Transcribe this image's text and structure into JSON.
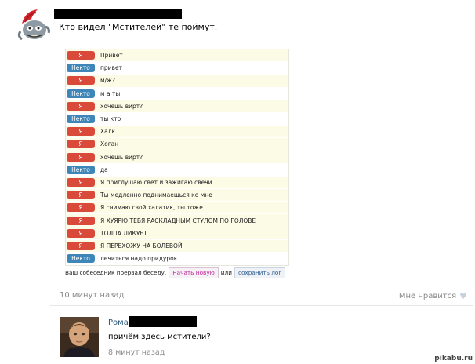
{
  "post": {
    "title": "Кто видел \"Мстителей\" те поймут.",
    "time": "10 минут назад",
    "like_label": "Мне нравится"
  },
  "chat": {
    "messages": [
      {
        "who": "me",
        "badge": "Я",
        "text": "Привет"
      },
      {
        "who": "stranger",
        "badge": "Некто",
        "text": "привет"
      },
      {
        "who": "me",
        "badge": "Я",
        "text": "м/ж?"
      },
      {
        "who": "stranger",
        "badge": "Некто",
        "text": "м а ты"
      },
      {
        "who": "me",
        "badge": "Я",
        "text": "хочешь вирт?"
      },
      {
        "who": "stranger",
        "badge": "Некто",
        "text": "ты кто"
      },
      {
        "who": "me",
        "badge": "Я",
        "text": "Халк."
      },
      {
        "who": "me",
        "badge": "Я",
        "text": "Хоган"
      },
      {
        "who": "me",
        "badge": "Я",
        "text": "хочешь вирт?"
      },
      {
        "who": "stranger",
        "badge": "Некто",
        "text": "да"
      },
      {
        "who": "me",
        "badge": "Я",
        "text": "Я приглушаю свет и зажигаю свечи"
      },
      {
        "who": "me",
        "badge": "Я",
        "text": "Ты медленно поднимаешься ко мне"
      },
      {
        "who": "me",
        "badge": "Я",
        "text": "Я снимаю свой халатик, ты тоже"
      },
      {
        "who": "me",
        "badge": "Я",
        "text": "Я ХУЯРЮ ТЕБЯ РАСКЛАДНЫМ СТУЛОМ ПО ГОЛОВЕ"
      },
      {
        "who": "me",
        "badge": "Я",
        "text": "ТОЛПА ЛИКУЕТ"
      },
      {
        "who": "me",
        "badge": "Я",
        "text": "Я ПЕРЕХОЖУ НА БОЛЕВОЙ"
      },
      {
        "who": "stranger",
        "badge": "Некто",
        "text": "лечиться надо придурок"
      }
    ],
    "end_text": "Ваш собеседник прервал беседу.",
    "new_button": "Начать новую",
    "or_text": "или",
    "save_button": "сохранить лог"
  },
  "comment": {
    "author": "Рома",
    "text": "причём здесь мстители?",
    "time": "8 минут назад"
  },
  "watermark": "pikabu.ru",
  "colors": {
    "me_badge": "#d94a3b",
    "stranger_badge": "#3f86b8",
    "me_row": "#fbfbe6",
    "link": "#2b587a"
  }
}
